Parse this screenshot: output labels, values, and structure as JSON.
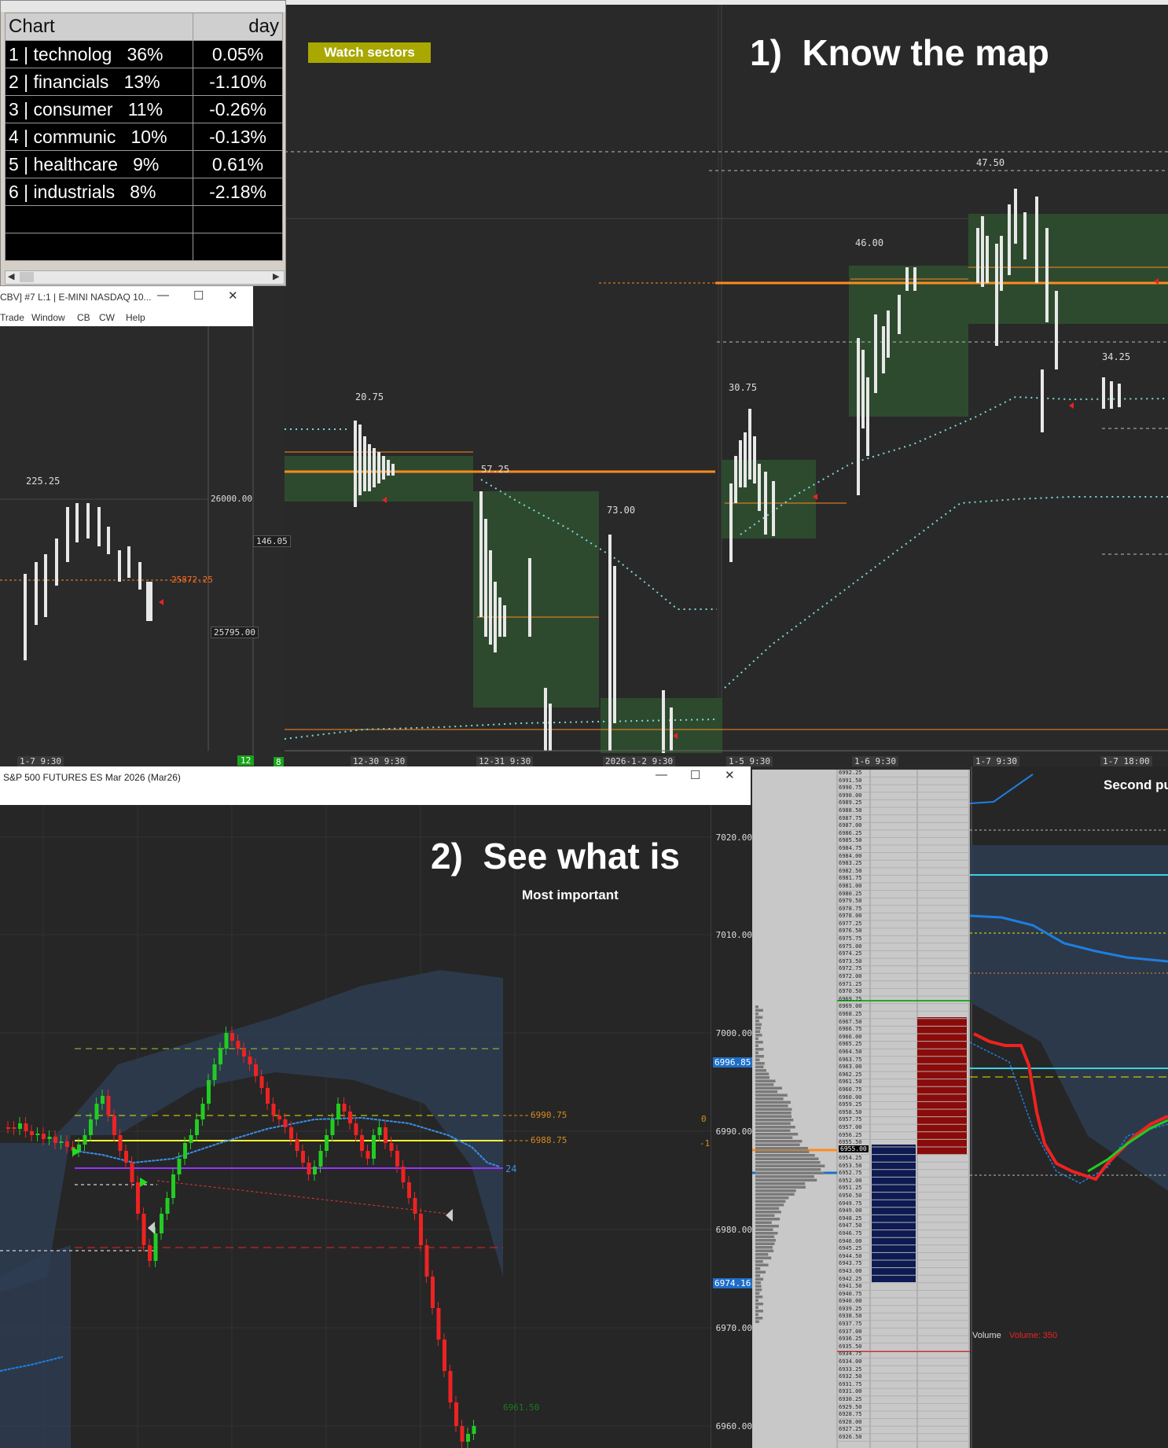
{
  "sector_window": {
    "header": {
      "chart": "Chart",
      "day": "day"
    },
    "rows": [
      {
        "label": "1 | technolog   36%",
        "change": "0.05%",
        "dir": "pos"
      },
      {
        "label": "2 | financials   13%",
        "change": "-1.10%",
        "dir": "neg"
      },
      {
        "label": "3 | consumer   11%",
        "change": "-0.26%",
        "dir": "neg"
      },
      {
        "label": "4 | communic   10%",
        "change": "-0.13%",
        "dir": "neg"
      },
      {
        "label": "5 | healthcare   9%",
        "change": "0.61%",
        "dir": "pos"
      },
      {
        "label": "6 | industrials   8%",
        "change": "-2.18%",
        "dir": "neg"
      }
    ]
  },
  "nq_window": {
    "title": "CBV] #7 L:1 | E-MINI NASDAQ 10...",
    "menu": [
      "Trade",
      "Window",
      "CB",
      "CW",
      "Help"
    ],
    "labels": {
      "range": "225.25",
      "price_high": "26000.00",
      "price_mid": "25872.25",
      "price_low": "25795.00",
      "tick": "146.05"
    },
    "date": "1-7  9:30",
    "badge": "12"
  },
  "tpo_chart": {
    "tag": "Watch sectors",
    "heading": "1)  Know the map",
    "ranges": [
      "20.75",
      "57.25",
      "73.00",
      "30.75",
      "46.00",
      "47.50",
      "34.25"
    ],
    "dates": [
      "12-30  9:30",
      "12-31  9:30",
      "2026-1-2  9:30",
      "1-5  9:30",
      "1-6  9:30",
      "1-7  9:30",
      "1-7  18:00"
    ],
    "badge": "8"
  },
  "es_window": {
    "title": "S&P 500 FUTURES ES Mar 2026 (Mar26)",
    "heading": "2)  See what is",
    "subheading": "Most important",
    "levels": {
      "upper": "6990.75",
      "lower": "6988.75",
      "blue": "24",
      "zero": "0",
      "neg1": "-1"
    },
    "price_axis": [
      "7020.00",
      "7010.00",
      "7000.00",
      "6990.00",
      "6980.00",
      "6970.00",
      "6960.00"
    ],
    "price_marks": {
      "top": "6996.85",
      "bottom": "6974.16"
    },
    "last": "6961.50"
  },
  "dom": {
    "current_price": "6955.00",
    "top_prices": [
      "6992.25",
      "6991.50",
      "6990.75",
      "6990.00",
      "6989.25",
      "6988.50",
      "6987.75",
      "6987.00",
      "6986.25",
      "6985.50",
      "6984.75",
      "6984.00",
      "6983.25",
      "6982.50",
      "6981.75",
      "6981.00",
      "6980.25",
      "6979.50",
      "6978.75",
      "6978.00",
      "6977.25",
      "6976.50",
      "6975.75",
      "6975.00",
      "6974.25",
      "6973.50",
      "6972.75",
      "6972.00",
      "6971.25",
      "6970.50",
      "6969.75",
      "6969.00",
      "6968.25",
      "6967.50",
      "6966.75",
      "6966.00",
      "6965.25",
      "6964.50",
      "6963.75",
      "6963.00",
      "6962.25",
      "6961.50",
      "6960.75",
      "6960.00",
      "6959.25",
      "6958.50",
      "6957.75",
      "6957.00",
      "6956.25",
      "6955.50"
    ],
    "bottom_prices": [
      "6954.25",
      "6953.50",
      "6952.75",
      "6952.00",
      "6951.25",
      "6950.50",
      "6949.75",
      "6949.00",
      "6948.25",
      "6947.50",
      "6946.75",
      "6946.00",
      "6945.25",
      "6944.50",
      "6943.75",
      "6943.00",
      "6942.25",
      "6941.50",
      "6940.75",
      "6940.00",
      "6939.25",
      "6938.50",
      "6937.75",
      "6937.00",
      "6936.25",
      "6935.50",
      "6934.75",
      "6934.00",
      "6933.25",
      "6932.50",
      "6931.75",
      "6931.00",
      "6930.25",
      "6929.50",
      "6928.75",
      "6928.00",
      "6927.25",
      "6926.50"
    ]
  },
  "right_panel": {
    "heading": "Second pu",
    "volume_label": "Volume",
    "volume_value": "Volume: 350"
  },
  "colors": {
    "up": "#22cc22",
    "down": "#ee2222",
    "accent": "#ff8a1e",
    "value_area": "#2f4a2f",
    "dot": "#7fd8d8",
    "vwap": "#1e7fe0"
  }
}
